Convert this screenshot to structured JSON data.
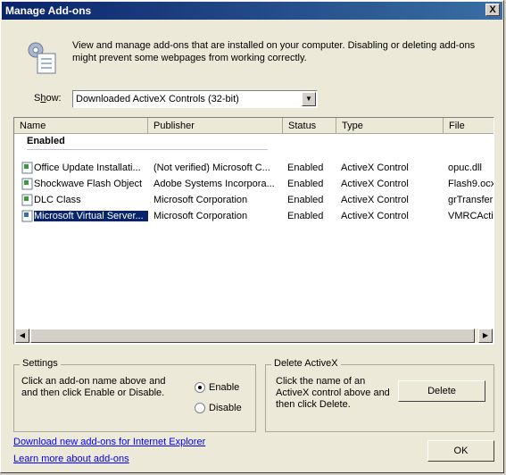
{
  "window": {
    "title": "Manage Add-ons",
    "close_label": "X"
  },
  "intro": {
    "text": "View and manage add-ons that are installed on your computer. Disabling or deleting add-ons might prevent some webpages from working correctly."
  },
  "show": {
    "label_prefix": "S",
    "label_underline": "h",
    "label_suffix": "ow:",
    "selected": "Downloaded ActiveX Controls (32-bit)"
  },
  "list": {
    "columns": [
      "Name",
      "Publisher",
      "Status",
      "Type",
      "File"
    ],
    "group": "Enabled",
    "rows": [
      {
        "name": "Office Update Installati...",
        "publisher": "(Not verified) Microsoft C...",
        "status": "Enabled",
        "type": "ActiveX Control",
        "file": "opuc.dll"
      },
      {
        "name": "Shockwave Flash Object",
        "publisher": "Adobe Systems Incorpora...",
        "status": "Enabled",
        "type": "ActiveX Control",
        "file": "Flash9.ocx"
      },
      {
        "name": "DLC Class",
        "publisher": "Microsoft Corporation",
        "status": "Enabled",
        "type": "ActiveX Control",
        "file": "grTransfer"
      },
      {
        "name": "Microsoft Virtual Server...",
        "publisher": "Microsoft Corporation",
        "status": "Enabled",
        "type": "ActiveX Control",
        "file": "VMRCActiv"
      }
    ]
  },
  "settings": {
    "title": "Settings",
    "text": "Click an add-on name above and and then click Enable or Disable.",
    "enable_label": "Enable",
    "disable_label": "Disable"
  },
  "delete_section": {
    "title": "Delete ActiveX",
    "text": "Click the name of an ActiveX control above and then click Delete.",
    "button_label": "Delete"
  },
  "links": {
    "download": "Download new add-ons for Internet Explorer",
    "learn": "Learn more about add-ons"
  },
  "ok_label": "OK"
}
